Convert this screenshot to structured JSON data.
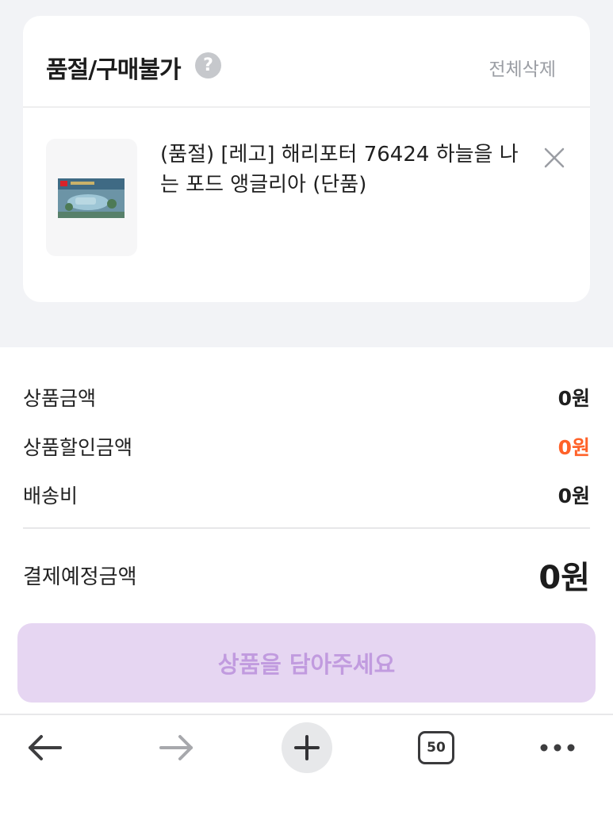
{
  "soldout_card": {
    "title": "품절/구매불가",
    "help_symbol": "?",
    "delete_all_label": "전체삭제",
    "item": {
      "name": "(품절) [레고] 해리포터 76424 하늘을 나는 포드 앵글리아 (단품)"
    }
  },
  "summary": {
    "rows": [
      {
        "label": "상품금액",
        "value": "0원"
      },
      {
        "label": "상품할인금액",
        "value": "0원"
      },
      {
        "label": "배송비",
        "value": "0원"
      }
    ],
    "total": {
      "label": "결제예정금액",
      "value": "0원"
    }
  },
  "cta": {
    "label": "상품을 담아주세요"
  },
  "browser_bar": {
    "tab_count": "50"
  },
  "colors": {
    "discount": "#ff6229",
    "cta_bg": "#e6d6f2",
    "cta_text": "#c19bdf"
  }
}
